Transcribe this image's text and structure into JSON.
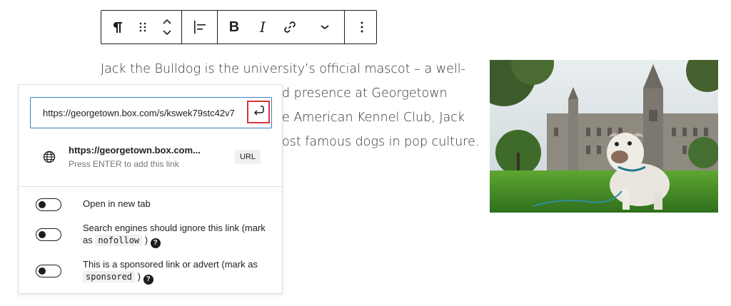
{
  "toolbar": {
    "paragraph_icon": "paragraph-icon",
    "drag_icon": "drag-handle-icon",
    "move_icon": "move-up-down-icon",
    "align_icon": "align-left-icon",
    "bold_label": "B",
    "italic_label": "I",
    "link_icon": "link-icon",
    "more_icon": "chevron-down-icon",
    "options_icon": "more-vertical-icon"
  },
  "paragraph": {
    "lines": [
      "Jack the Bulldog is the university’s official mascot – a well-",
      "d presence at Georgetown",
      "e American Kennel Club, Jack",
      "ost famous dogs in pop culture."
    ]
  },
  "image": {
    "semantic": "bulldog-in-front-of-georgetown-hall"
  },
  "link_popover": {
    "url_value": "https://georgetown.box.com/s/kswek79stc42v7",
    "submit_icon": "enter-return-icon",
    "suggestion": {
      "title": "https://georgetown.box.com...",
      "subtitle": "Press ENTER to add this link",
      "badge": "URL",
      "icon": "globe-icon"
    },
    "options": {
      "new_tab": {
        "label": "Open in new tab",
        "checked": false
      },
      "nofollow": {
        "label_before": "Search engines should ignore this link (mark as ",
        "code": "nofollow",
        "label_after": ")",
        "help": "?",
        "checked": false
      },
      "sponsored": {
        "label_before": "This is a sponsored link or advert (mark as ",
        "code": "sponsored",
        "label_after": ")",
        "help": "?",
        "checked": false
      }
    }
  },
  "colors": {
    "focus_blue": "#3582c4",
    "highlight_red": "#d63638",
    "text_dark": "#1e1e1e",
    "text_muted": "#757575"
  }
}
